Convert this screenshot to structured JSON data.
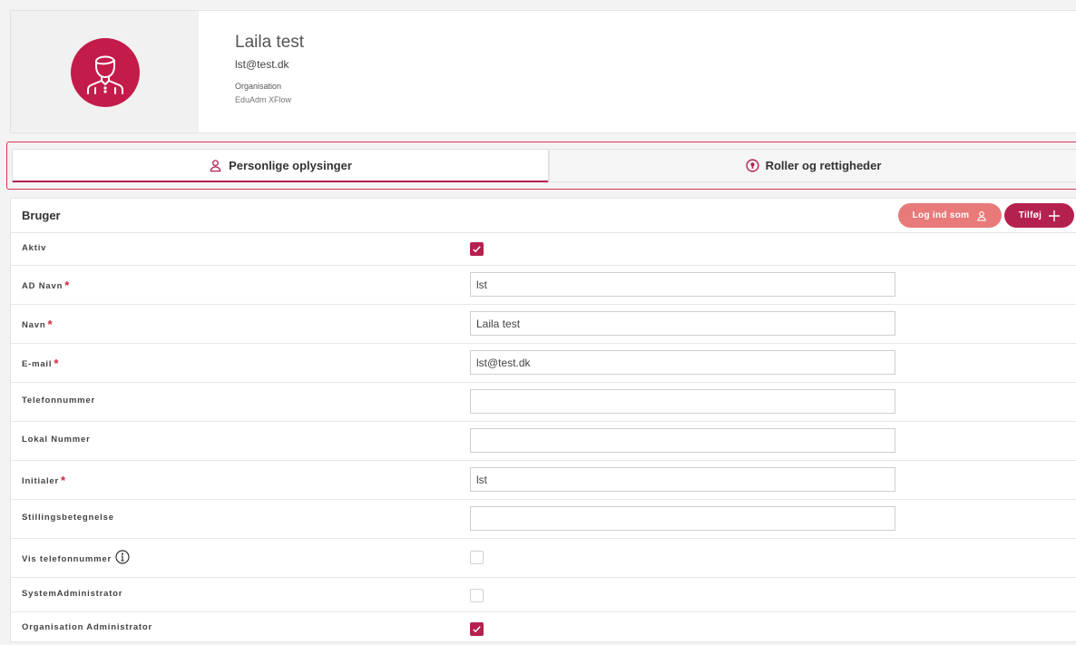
{
  "profile": {
    "name": "Laila test",
    "email": "lst@test.dk",
    "organisation_label": "Organisation",
    "organisation_value": "EduAdm XFlow",
    "avatar_icon": "user-avatar-icon",
    "avatar_color": "#c41c4a"
  },
  "tabs": [
    {
      "label": "Personlige oplysinger",
      "icon": "person-icon",
      "active": true
    },
    {
      "label": "Roller og rettigheder",
      "icon": "lock-circle-icon",
      "active": false
    }
  ],
  "panel": {
    "title": "Bruger",
    "login_button": "Log ind som",
    "add_button": "Tilføj"
  },
  "fields": {
    "aktiv": {
      "label": "Aktiv",
      "checked": true
    },
    "ad_navn": {
      "label": "AD Navn",
      "value": "lst",
      "required": "*"
    },
    "navn": {
      "label": "Navn",
      "value": "Laila test",
      "required": "*"
    },
    "email": {
      "label": "E-mail",
      "value": "lst@test.dk",
      "required": "*"
    },
    "telefon": {
      "label": "Telefonnummer",
      "value": ""
    },
    "lokal": {
      "label": "Lokal Nummer",
      "value": ""
    },
    "initialer": {
      "label": "Initialer",
      "value": "lst",
      "required": "*"
    },
    "stilling": {
      "label": "Stillingsbetegnelse",
      "value": ""
    },
    "vis_telefon": {
      "label": "Vis telefonnummer",
      "checked": false
    },
    "sysadmin": {
      "label": "SystemAdministrator",
      "checked": false
    },
    "orgadmin": {
      "label": "Organisation Administrator",
      "checked": true
    }
  },
  "colors": {
    "accent": "#b5214f",
    "login_button": "#e97a7a",
    "required": "#d0243f",
    "tab_highlight_border": "#d9364f"
  }
}
